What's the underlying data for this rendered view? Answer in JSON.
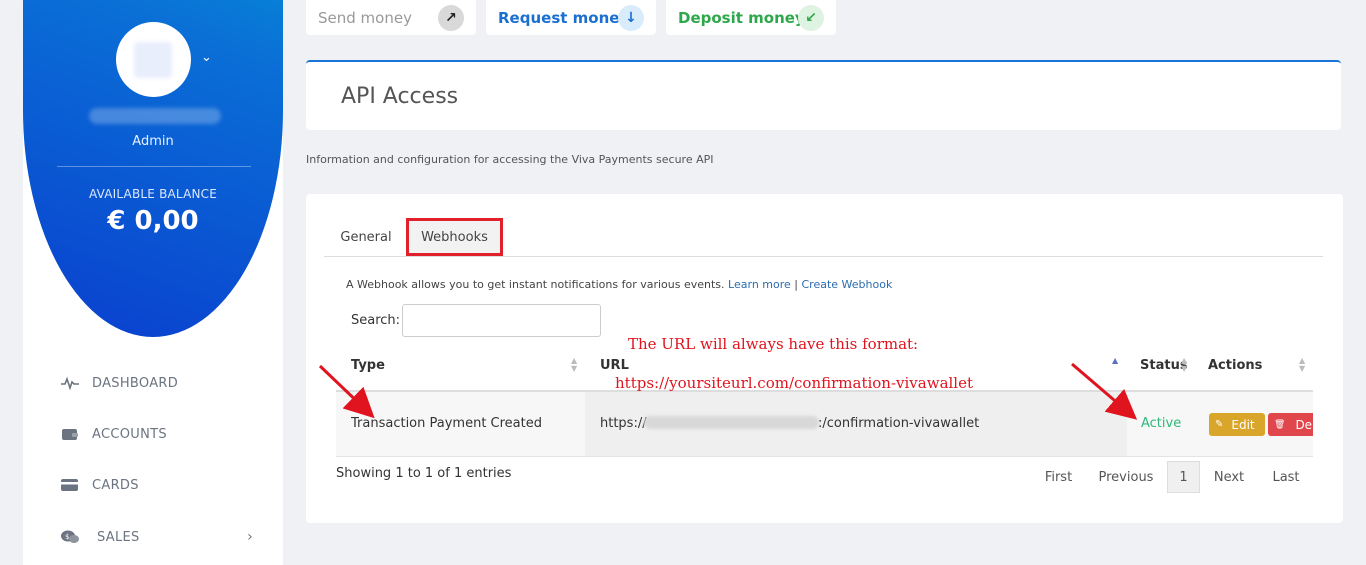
{
  "sidebar": {
    "role": "Admin",
    "balance_label": "AVAILABLE BALANCE",
    "balance_value": "€ 0,00",
    "items": [
      {
        "label": "DASHBOARD"
      },
      {
        "label": "ACCOUNTS"
      },
      {
        "label": "CARDS"
      },
      {
        "label": "SALES"
      }
    ]
  },
  "actions": {
    "send": "Send money",
    "request": "Request money",
    "deposit": "Deposit money"
  },
  "header": {
    "title": "API Access",
    "subtitle": "Information and configuration for accessing the Viva Payments secure API"
  },
  "tabs": [
    {
      "label": "General"
    },
    {
      "label": "Webhooks"
    }
  ],
  "webhooks": {
    "info_text": "A Webhook allows you to get instant notifications for various events.",
    "learn_more": "Learn more",
    "separator": "|",
    "create_webhook": "Create Webhook",
    "search_label": "Search:",
    "search_value": "",
    "columns": [
      "Type",
      "URL",
      "Status",
      "Actions"
    ],
    "rows": [
      {
        "type": "Transaction Payment Created",
        "url_prefix": "https://",
        "url_suffix": ":/confirmation-vivawallet",
        "status": "Active",
        "edit_label": "Edit",
        "delete_label": "De"
      }
    ],
    "showing": "Showing 1 to 1 of 1 entries",
    "pagination": {
      "first": "First",
      "previous": "Previous",
      "current": "1",
      "next": "Next",
      "last": "Last"
    }
  },
  "annotations": {
    "line1": "The URL will always have this format:",
    "line2": "https://yoursiteurl.com/confirmation-vivawallet",
    "color": "#e0141e"
  },
  "colors": {
    "brand_blue": "#1a73d6",
    "active_green": "#2eb87a",
    "edit_yellow": "#d9a62b",
    "delete_red": "#e0474c",
    "request_blue": "#1a6fd0",
    "deposit_green": "#2ea84a"
  }
}
